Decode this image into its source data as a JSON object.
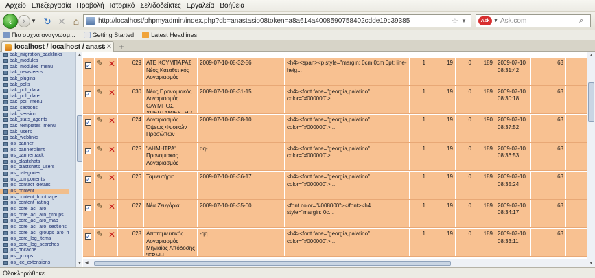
{
  "menu": [
    "Αρχείο",
    "Επεξεργασία",
    "Προβολή",
    "Ιστορικό",
    "Σελιδοδείκτες",
    "Εργαλεία",
    "Βοήθεια"
  ],
  "address": {
    "url": "http://localhost/phpmyadmin/index.php?db=anastasio08token=a8a614a4008590758402cdde19c39385"
  },
  "search": {
    "engine_label": "Ask",
    "placeholder": "Ask.com"
  },
  "bookmarks": [
    "Πιο συχνά αναγνωσμ...",
    "Getting Started",
    "Latest Headlines"
  ],
  "tab": {
    "title": "localhost / localhost / anastasioo / j..."
  },
  "sidebar": {
    "active": "jos_content",
    "items": [
      "bak_migration_backlinks",
      "bak_modules",
      "bak_modules_menu",
      "bak_newsfeeds",
      "bak_plugins",
      "bak_polls",
      "bak_poll_data",
      "bak_poll_date",
      "bak_poll_menu",
      "bak_sections",
      "bak_session",
      "bak_stats_agents",
      "bak_templates_menu",
      "bak_users",
      "bak_weblinks",
      "jos_banner",
      "jos_bannerclient",
      "jos_bannertrack",
      "jos_blastchats",
      "jos_blastchats_users",
      "jos_categories",
      "jos_components",
      "jos_contact_details",
      "jos_content",
      "jos_content_frontpage",
      "jos_content_rating",
      "jos_core_acl_aro",
      "jos_core_acl_aro_groups",
      "jos_core_acl_aro_map",
      "jos_core_acl_aro_sections",
      "jos_core_acl_groups_aro_map",
      "jos_core_log_items",
      "jos_core_log_searches",
      "jos_dbcache",
      "jos_groups",
      "jos_jce_extensions"
    ]
  },
  "rows": [
    {
      "id": "629",
      "title": "ΑΤΕ ΚΟΥΜΠΑΡΑΣ Νέος Καταθετικός Λογαριασμός",
      "alias": "2009-07-10-08-32-56",
      "text": "<h4><span><p style=\"margin: 0cm 0cm 0pt; line-heig...",
      "c1": "1",
      "c2": "19",
      "c3": "0",
      "c4": "189",
      "date": "2009-07-10 08:31:42",
      "last": "63"
    },
    {
      "id": "630",
      "title": "Νέος Προνομιακός Λογαριασμός ΟΛΥΜΠΟΣ ΥΠΕΡΤΑΜΙΕΥΤΗΡ...",
      "alias": "2009-07-10-08-31-15",
      "text": "<h4><font face=\"georgia,palatino\" color=\"#000000\">...",
      "c1": "1",
      "c2": "19",
      "c3": "0",
      "c4": "189",
      "date": "2009-07-10 08:30:18",
      "last": "63"
    },
    {
      "id": "624",
      "title": "Λογαριασμός Όψεως Φυσικών Προσώπων",
      "alias": "2009-07-10-08-38-10",
      "text": "<h4><font face=\"georgia,palatino\" color=\"#000000\">...",
      "c1": "1",
      "c2": "19",
      "c3": "0",
      "c4": "190",
      "date": "2009-07-10 08:37:52",
      "last": "63"
    },
    {
      "id": "625",
      "title": "\"ΔΗΜΗΤΡΑ\" Προνομιακός Λογαριασμός",
      "alias": "qq-",
      "text": "<h4><font face=\"georgia,palatino\" color=\"#000000\">...",
      "c1": "1",
      "c2": "19",
      "c3": "0",
      "c4": "189",
      "date": "2009-07-10 08:36:53",
      "last": "63"
    },
    {
      "id": "626",
      "title": "Ταμιευτήριο",
      "alias": "2009-07-10-08-36-17",
      "text": "<h4><font face=\"georgia,palatino\" color=\"#000000\">...",
      "c1": "1",
      "c2": "19",
      "c3": "0",
      "c4": "189",
      "date": "2009-07-10 08:35:24",
      "last": "63"
    },
    {
      "id": "627",
      "title": "Νέα Ζευγάρια",
      "alias": "2009-07-10-08-35-00",
      "text": "<font color=\"#008000\"></font><h4 style=\"margin: 0c...",
      "c1": "1",
      "c2": "19",
      "c3": "0",
      "c4": "189",
      "date": "2009-07-10 08:34:17",
      "last": "63"
    },
    {
      "id": "628",
      "title": "Αποταμιευτικός Λογαριασμός Μηνιαίας Απόδοσης \"ΕΡΜΗ...",
      "alias": "-qq",
      "text": "<h4><font face=\"georgia,palatino\" color=\"#000000\">...",
      "c1": "1",
      "c2": "19",
      "c3": "0",
      "c4": "189",
      "date": "2009-07-10 08:33:11",
      "last": "63"
    }
  ],
  "status": {
    "text": "Ολοκληρώθηκε"
  }
}
